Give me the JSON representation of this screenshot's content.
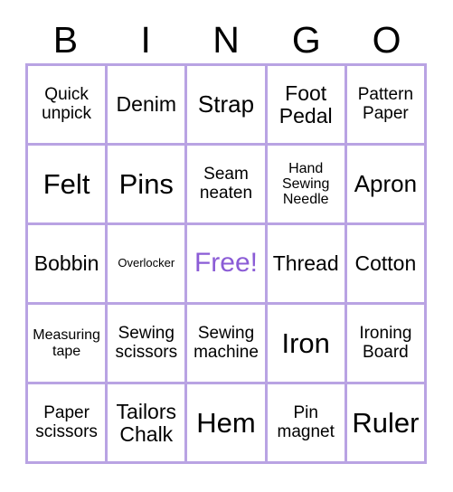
{
  "card": {
    "title": "BINGO",
    "header_letters": [
      "B",
      "I",
      "N",
      "G",
      "O"
    ],
    "colors": {
      "grid_line": "#b9a3e3",
      "free_text": "#8b5cd6",
      "cell_text": "#000000",
      "background": "#ffffff"
    },
    "grid": {
      "rows": 5,
      "columns": 5,
      "cells": [
        [
          {
            "label": "Quick unpick",
            "size": "md",
            "free": false
          },
          {
            "label": "Denim",
            "size": "lg",
            "free": false
          },
          {
            "label": "Strap",
            "size": "xl",
            "free": false
          },
          {
            "label": "Foot Pedal",
            "size": "lg",
            "free": false
          },
          {
            "label": "Pattern Paper",
            "size": "md",
            "free": false
          }
        ],
        [
          {
            "label": "Felt",
            "size": "xxl",
            "free": false
          },
          {
            "label": "Pins",
            "size": "xxl",
            "free": false
          },
          {
            "label": "Seam neaten",
            "size": "md",
            "free": false
          },
          {
            "label": "Hand Sewing Needle",
            "size": "sm",
            "free": false
          },
          {
            "label": "Apron",
            "size": "xl",
            "free": false
          }
        ],
        [
          {
            "label": "Bobbin",
            "size": "lg",
            "free": false
          },
          {
            "label": "Overlocker",
            "size": "xs",
            "free": false
          },
          {
            "label": "Free!",
            "size": "xl",
            "free": true
          },
          {
            "label": "Thread",
            "size": "lg",
            "free": false
          },
          {
            "label": "Cotton",
            "size": "lg",
            "free": false
          }
        ],
        [
          {
            "label": "Measuring tape",
            "size": "sm",
            "free": false
          },
          {
            "label": "Sewing scissors",
            "size": "md",
            "free": false
          },
          {
            "label": "Sewing machine",
            "size": "md",
            "free": false
          },
          {
            "label": "Iron",
            "size": "xxl",
            "free": false
          },
          {
            "label": "Ironing Board",
            "size": "md",
            "free": false
          }
        ],
        [
          {
            "label": "Paper scissors",
            "size": "md",
            "free": false
          },
          {
            "label": "Tailors Chalk",
            "size": "lg",
            "free": false
          },
          {
            "label": "Hem",
            "size": "xxl",
            "free": false
          },
          {
            "label": "Pin magnet",
            "size": "md",
            "free": false
          },
          {
            "label": "Ruler",
            "size": "xxl",
            "free": false
          }
        ]
      ]
    }
  }
}
